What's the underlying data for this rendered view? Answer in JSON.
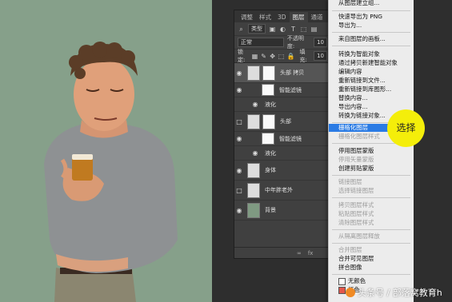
{
  "panel": {
    "tabs": [
      "调整",
      "样式",
      "3D",
      "图层",
      "通道"
    ],
    "active_tab": "图层",
    "filter_kind": "类型",
    "blend_mode": "正常",
    "opacity_label": "不透明度:",
    "opacity_value": "10",
    "lock_label": "锁定:",
    "fill_label": "填充:",
    "fill_value": "10",
    "layers": [
      {
        "name": "头部 拷贝"
      },
      {
        "name": "智能滤镜"
      },
      {
        "name": "液化"
      },
      {
        "name": "头部"
      },
      {
        "name": "智能滤镜"
      },
      {
        "name": "液化"
      },
      {
        "name": "身体"
      },
      {
        "name": "中年胖老外"
      },
      {
        "name": "背景"
      }
    ],
    "footer_icons": [
      "link-icon",
      "fx-icon"
    ],
    "footer_fx": "fx"
  },
  "menu": {
    "items": [
      {
        "label": "从图层建立组...",
        "disabled": false
      },
      {
        "label": "快速导出为 PNG",
        "disabled": false
      },
      {
        "label": "导出为...",
        "disabled": false
      },
      {
        "label": "来自图层的画板...",
        "disabled": false
      },
      {
        "label": "转换为智能对象",
        "disabled": false
      },
      {
        "label": "通过拷贝新建智能对象",
        "disabled": false
      },
      {
        "label": "编辑内容",
        "disabled": false
      },
      {
        "label": "重新链接到文件...",
        "disabled": false
      },
      {
        "label": "重新链接到库图形...",
        "disabled": false
      },
      {
        "label": "替换内容...",
        "disabled": false
      },
      {
        "label": "导出内容...",
        "disabled": false
      },
      {
        "label": "转换为链接对象...",
        "disabled": false
      },
      {
        "label": "栅格化图层",
        "disabled": false,
        "highlighted": true
      },
      {
        "label": "栅格化图层样式",
        "disabled": true
      },
      {
        "label": "停用图层蒙版",
        "disabled": false
      },
      {
        "label": "停用矢量蒙版",
        "disabled": true
      },
      {
        "label": "创建剪贴蒙版",
        "disabled": false
      },
      {
        "label": "链接图层",
        "disabled": true
      },
      {
        "label": "选择链接图层",
        "disabled": true
      },
      {
        "label": "拷贝图层样式",
        "disabled": true
      },
      {
        "label": "粘贴图层样式",
        "disabled": true
      },
      {
        "label": "清除图层样式",
        "disabled": true
      },
      {
        "label": "从隔离图层释放",
        "disabled": true
      },
      {
        "label": "合并图层",
        "disabled": true
      },
      {
        "label": "合并可见图层",
        "disabled": false
      },
      {
        "label": "拼合图像",
        "disabled": false
      },
      {
        "label": "无颜色",
        "disabled": false
      },
      {
        "label": "红色",
        "disabled": false
      }
    ],
    "highlight_color": "#2a7be4"
  },
  "callout": {
    "text": "选择",
    "color": "#f4ee0a"
  },
  "watermark": {
    "text": "头条号 / 部落窝教育h"
  },
  "canvas": {
    "background": "#86a08a"
  }
}
